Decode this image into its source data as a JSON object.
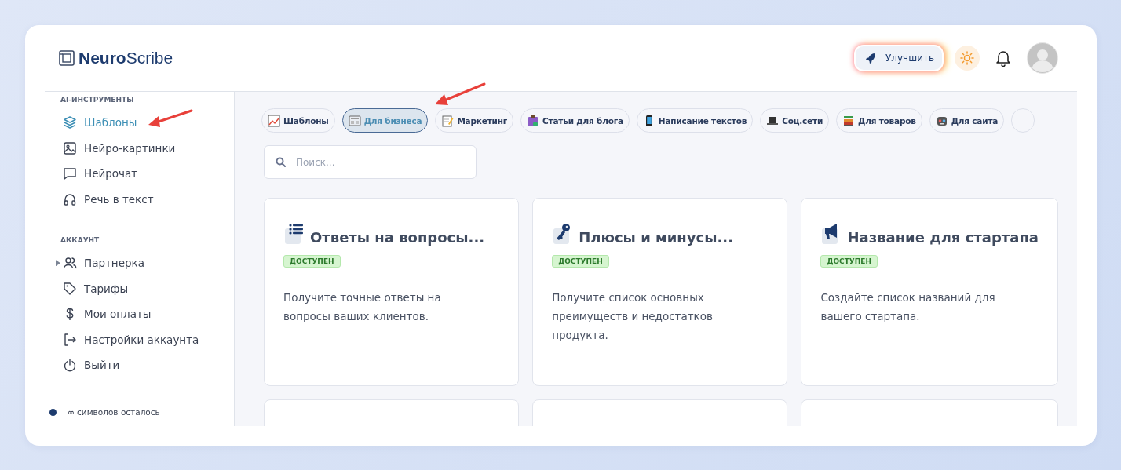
{
  "logo": {
    "bold": "Neuro",
    "light": "Scribe"
  },
  "header": {
    "upgrade": "Улучшить"
  },
  "sidebar": {
    "sections": [
      {
        "title": "AI-ИНСТРУМЕНТЫ",
        "items": [
          {
            "label": "Шаблоны",
            "selected": true,
            "expandable": false
          },
          {
            "label": "Нейро-картинки",
            "selected": false,
            "expandable": false
          },
          {
            "label": "Нейрочат",
            "selected": false,
            "expandable": false
          },
          {
            "label": "Речь в текст",
            "selected": false,
            "expandable": false
          }
        ]
      },
      {
        "title": "АККАУНТ",
        "items": [
          {
            "label": "Партнерка",
            "selected": false,
            "expandable": true
          },
          {
            "label": "Тарифы",
            "selected": false,
            "expandable": false
          },
          {
            "label": "Мои оплаты",
            "selected": false,
            "expandable": false
          },
          {
            "label": "Настройки аккаунта",
            "selected": false,
            "expandable": false
          },
          {
            "label": "Выйти",
            "selected": false,
            "expandable": false
          }
        ]
      }
    ],
    "footer": "**∞** символов осталось"
  },
  "categories": [
    {
      "label": "Шаблоны",
      "selected": false
    },
    {
      "label": "Для бизнеса",
      "selected": true
    },
    {
      "label": "Маркетинг",
      "selected": false
    },
    {
      "label": "Статьи для блога",
      "selected": false
    },
    {
      "label": "Написание текстов",
      "selected": false
    },
    {
      "label": "Соц.сети",
      "selected": false
    },
    {
      "label": "Для товаров",
      "selected": false
    },
    {
      "label": "Для сайта",
      "selected": false
    }
  ],
  "search": {
    "placeholder": "Поиск..."
  },
  "cards": [
    {
      "title": "Ответы на вопросы...",
      "badge": "ДОСТУПЕН",
      "description": "Получите точные ответы на вопросы ваших клиентов."
    },
    {
      "title": "Плюсы и минусы...",
      "badge": "ДОСТУПЕН",
      "description": "Получите список основных преимуществ и недостатков продукта."
    },
    {
      "title": "Название для стартапа",
      "badge": "ДОСТУПЕН",
      "description": "Создайте список названий для вашего стартапа."
    }
  ]
}
